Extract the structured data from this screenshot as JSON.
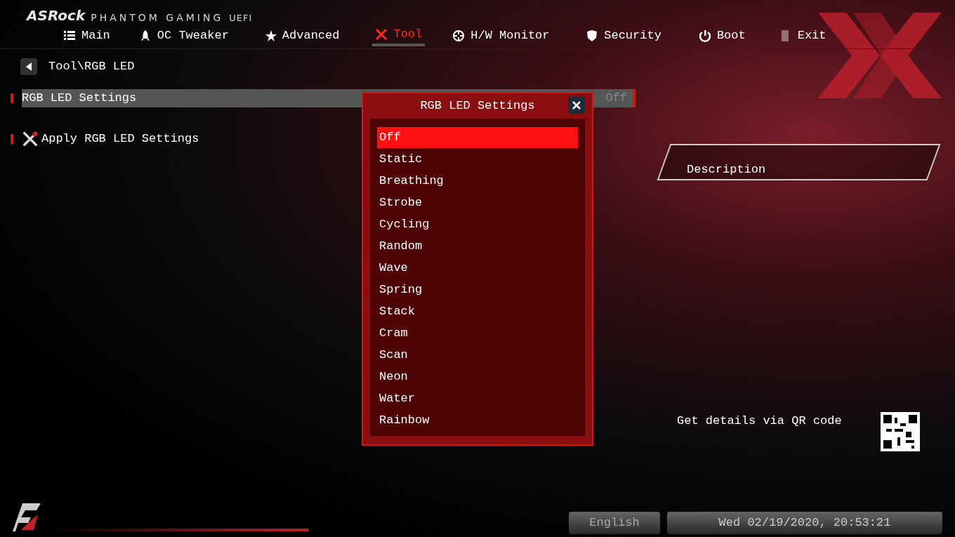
{
  "header": {
    "brand": "ASRock",
    "product": "PHANTOM GAMING",
    "suffix": "UEFI"
  },
  "tabs": [
    {
      "label": "Main",
      "selected": false
    },
    {
      "label": "OC Tweaker",
      "selected": false
    },
    {
      "label": "Advanced",
      "selected": false
    },
    {
      "label": "Tool",
      "selected": true
    },
    {
      "label": "H/W Monitor",
      "selected": false
    },
    {
      "label": "Security",
      "selected": false
    },
    {
      "label": "Boot",
      "selected": false
    },
    {
      "label": "Exit",
      "selected": false
    }
  ],
  "breadcrumb": "Tool\\RGB LED",
  "items": [
    {
      "kind": "setting",
      "label": "RGB LED Settings",
      "value": "Off",
      "selected": true
    },
    {
      "kind": "action",
      "label": "Apply RGB LED Settings",
      "selected": false
    }
  ],
  "dialog": {
    "title": "RGB LED Settings",
    "options": [
      {
        "label": "Off",
        "selected": true
      },
      {
        "label": "Static",
        "selected": false
      },
      {
        "label": "Breathing",
        "selected": false
      },
      {
        "label": "Strobe",
        "selected": false
      },
      {
        "label": "Cycling",
        "selected": false
      },
      {
        "label": "Random",
        "selected": false
      },
      {
        "label": "Wave",
        "selected": false
      },
      {
        "label": "Spring",
        "selected": false
      },
      {
        "label": "Stack",
        "selected": false
      },
      {
        "label": "Cram",
        "selected": false
      },
      {
        "label": "Scan",
        "selected": false
      },
      {
        "label": "Neon",
        "selected": false
      },
      {
        "label": "Water",
        "selected": false
      },
      {
        "label": "Rainbow",
        "selected": false
      }
    ]
  },
  "description": {
    "title": "Description",
    "qr_text": "Get details via QR code"
  },
  "status_bar": {
    "language": "English",
    "datetime": "Wed 02/19/2020, 20:53:21"
  }
}
